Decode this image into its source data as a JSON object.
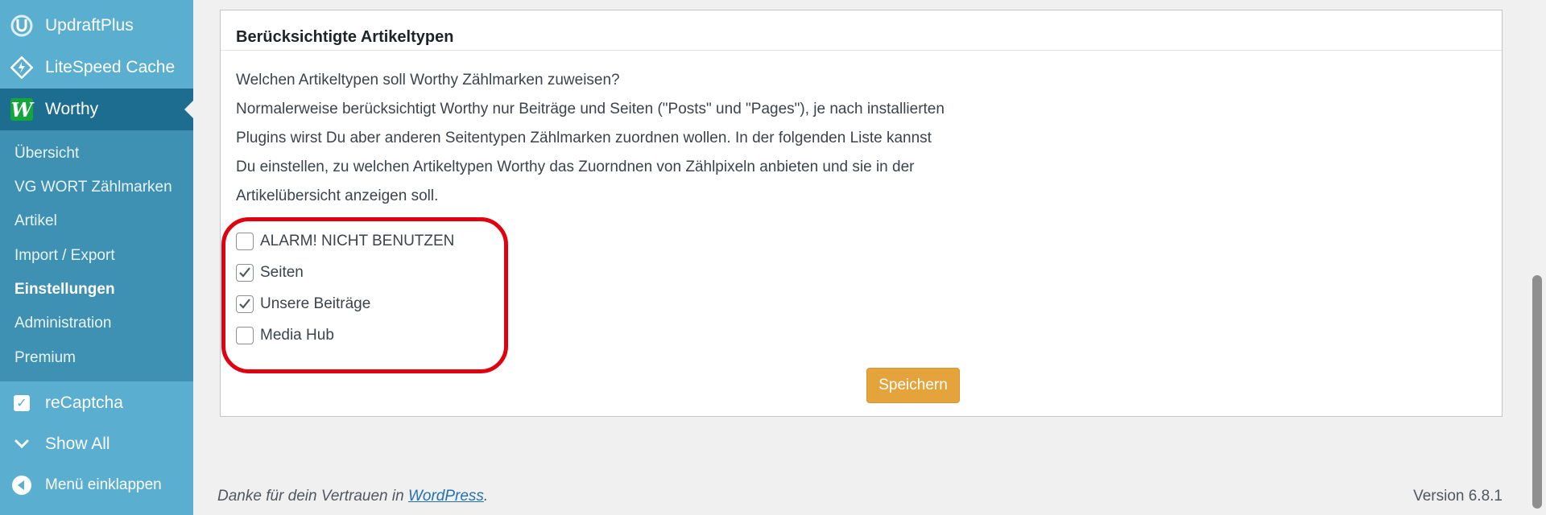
{
  "sidebar": {
    "menu": {
      "updraftplus": "UpdraftPlus",
      "litespeed": "LiteSpeed Cache",
      "worthy": "Worthy",
      "recaptcha": "reCaptcha",
      "show_all": "Show All",
      "collapse": "Menü einklappen"
    },
    "worthy_logo_letter": "W",
    "submenu": [
      {
        "label": "Übersicht",
        "current": false
      },
      {
        "label": "VG WORT Zählmarken",
        "current": false
      },
      {
        "label": "Artikel",
        "current": false
      },
      {
        "label": "Import / Export",
        "current": false
      },
      {
        "label": "Einstellungen",
        "current": true
      },
      {
        "label": "Administration",
        "current": false
      },
      {
        "label": "Premium",
        "current": false
      }
    ],
    "colors": {
      "background": "#5aaed0",
      "active": "#1d6d90",
      "submenu": "#3e91b3"
    }
  },
  "card": {
    "title": "Berücksichtigte Artikeltypen",
    "paragraph": [
      "Welchen Artikeltypen soll Worthy Zählmarken zuweisen?",
      "Normalerweise berücksichtigt Worthy nur Beiträge und Seiten (\"Posts\" und \"Pages\"), je nach installierten",
      "Plugins wirst Du aber anderen Seitentypen Zählmarken zuordnen wollen. In der folgenden Liste kannst",
      "Du einstellen, zu welchen Artikeltypen Worthy das Zuorndnen von Zählpixeln anbieten und sie in der",
      "Artikelübersicht anzeigen soll."
    ],
    "post_types": [
      {
        "label": "ALARM! NICHT BENUTZEN",
        "checked": false
      },
      {
        "label": "Seiten",
        "checked": true
      },
      {
        "label": "Unsere Beiträge",
        "checked": true
      },
      {
        "label": "Media Hub",
        "checked": false
      }
    ],
    "save_label": "Speichern",
    "colors": {
      "save_button": "#e4a43b",
      "highlight": "#e0000f"
    }
  },
  "footer": {
    "thanks_prefix": "Danke für dein Vertrauen in ",
    "wordpress_link": "WordPress",
    "thanks_suffix": ".",
    "version": "Version 6.8.1"
  }
}
